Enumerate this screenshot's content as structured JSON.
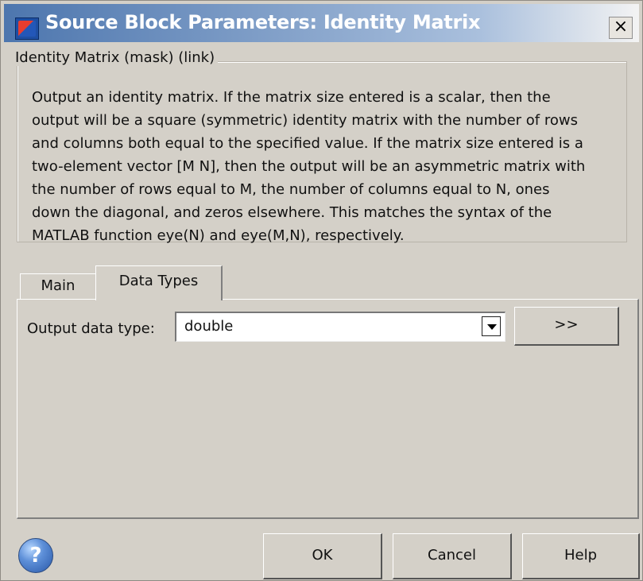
{
  "window": {
    "title": "Source Block Parameters: Identity Matrix",
    "close_label": "×"
  },
  "block": {
    "group_title": "Identity Matrix (mask) (link)",
    "description_lines": [
      "Output an identity matrix.  If the matrix size entered is a scalar, then the",
      "output will be a square (symmetric) identity matrix with the number of rows",
      "and columns both equal to the specified value.  If the matrix size entered is a",
      "two-element vector [M N], then the output will be an asymmetric matrix with",
      "the number of rows equal to M, the number of columns equal to N, ones",
      "down the diagonal, and zeros elsewhere.  This matches the syntax of the",
      "MATLAB function eye(N) and eye(M,N), respectively."
    ]
  },
  "tabs": [
    {
      "label": "Main",
      "active": false
    },
    {
      "label": "Data Types",
      "active": true
    }
  ],
  "data_types": {
    "output_label": "Output data type:",
    "output_value": "double",
    "expand_label": ">>"
  },
  "buttons": {
    "help_icon": "?",
    "ok": "OK",
    "cancel": "Cancel",
    "help": "Help"
  },
  "icons": {
    "app": "simulink-block-icon",
    "close": "close-icon",
    "dropdown": "chevron-down-icon",
    "help": "help-icon"
  },
  "colors": {
    "title_start": "#4d76ae",
    "title_end": "#f3f3f3",
    "dialog_background": "#d4d0c8"
  }
}
